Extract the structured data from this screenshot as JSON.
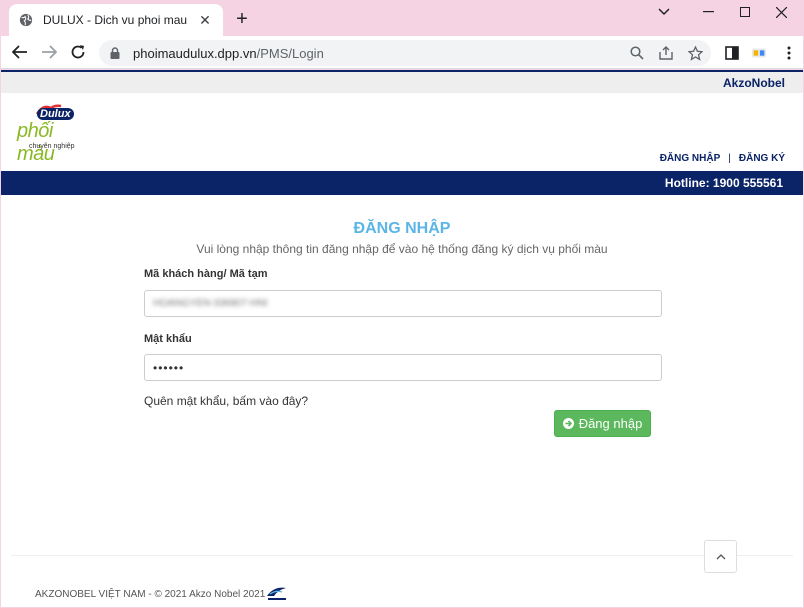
{
  "browser": {
    "tab_title": "DULUX - Dich vu phoi mau",
    "tab_close": "✕",
    "new_tab": "+",
    "url_host": "phoimaudulux.dpp.vn",
    "url_path": "/PMS/Login"
  },
  "site": {
    "brand_top": "AkzoNobel",
    "logo_dulux": "Dulux",
    "logo_phoimau": "phối màu",
    "logo_sub": "chuyên nghiệp",
    "nav_login": "ĐĂNG NHẬP",
    "nav_sep": "|",
    "nav_register": "ĐĂNG KÝ",
    "hotline": "Hotline: 1900 555561"
  },
  "form": {
    "heading": "ĐĂNG NHẬP",
    "subtext": "Vui lòng nhập thông tin đăng nhập để vào hệ thống đăng ký dịch vụ phối màu",
    "customer_label": "Mã khách hàng/ Mã tạm",
    "customer_value": "HOANGYEN-336807-HNI",
    "password_label": "Mật khẩu",
    "password_value": "••••••",
    "forgot": "Quên mật khẩu, bấm vào đây?",
    "login_button": "Đăng nhập"
  },
  "footer": {
    "copyright": "AKZONOBEL VIỆT NAM - © 2021 Akzo Nobel 2021"
  },
  "colors": {
    "navy": "#0b2367",
    "accent_blue": "#5bb5e6",
    "button_green": "#5cb85c",
    "tab_strip": "#f5d3e3"
  }
}
